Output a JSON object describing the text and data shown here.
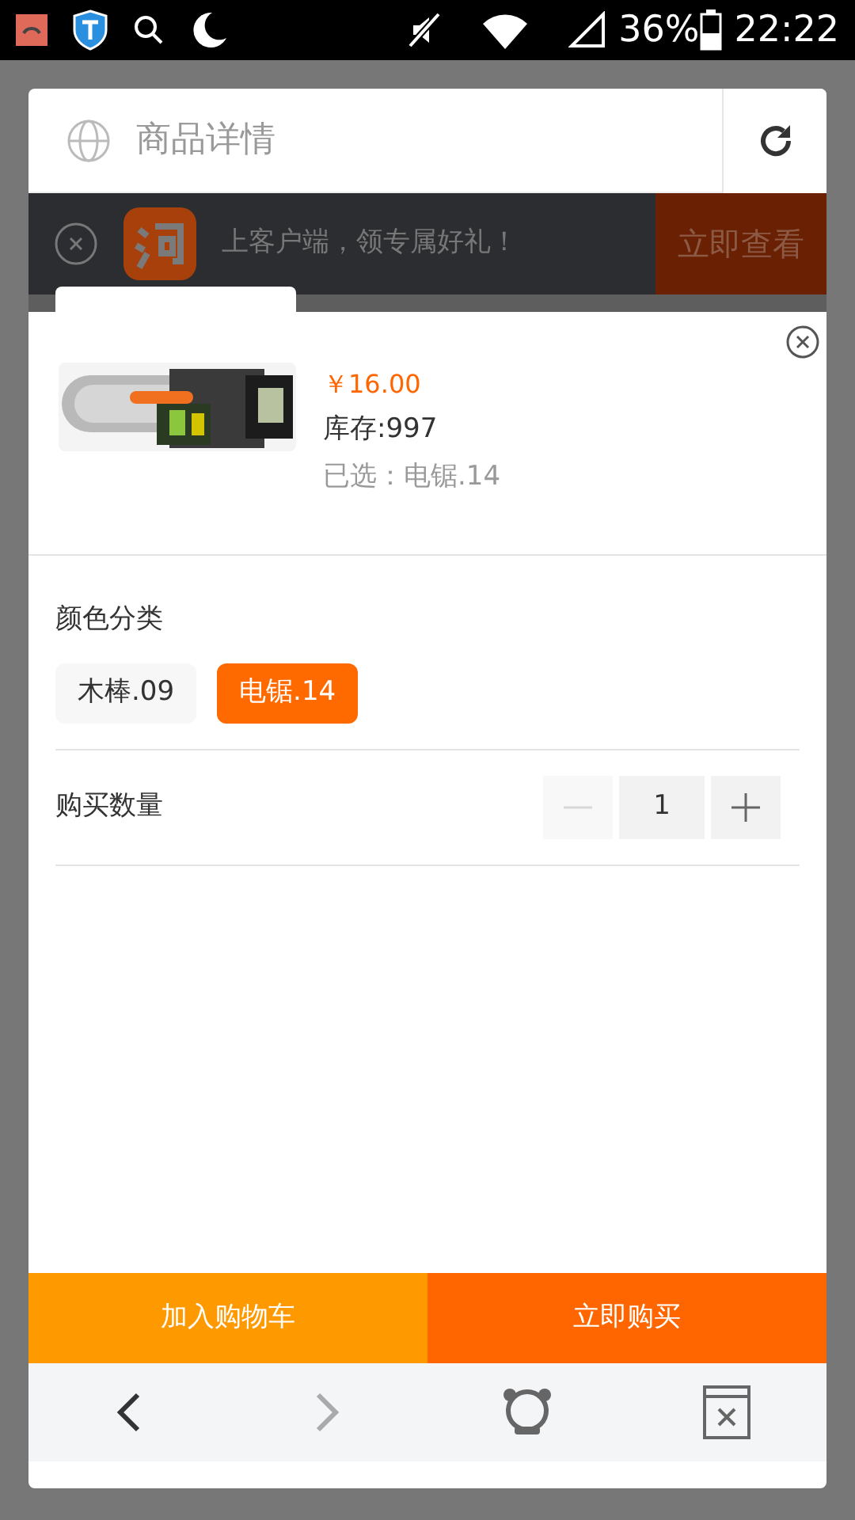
{
  "status_bar": {
    "battery": "36%",
    "time": "22:22"
  },
  "header": {
    "title": "商品详情"
  },
  "banner": {
    "text": "上客户端，领专属好礼！",
    "button": "立即查看"
  },
  "product": {
    "price": "￥16.00",
    "stock": "库存:997",
    "selected_text": "已选：电锯.14"
  },
  "options": {
    "label": "颜色分类",
    "items": [
      {
        "label": "木棒.09",
        "selected": false
      },
      {
        "label": "电锯.14",
        "selected": true
      }
    ]
  },
  "quantity": {
    "label": "购买数量",
    "value": "1",
    "minus_disabled": true
  },
  "actions": [
    {
      "label": "加入购物车",
      "kind": "cart"
    },
    {
      "label": "立即购买",
      "kind": "buy"
    }
  ],
  "nav": {
    "back_disabled": false,
    "forward_disabled": true
  }
}
